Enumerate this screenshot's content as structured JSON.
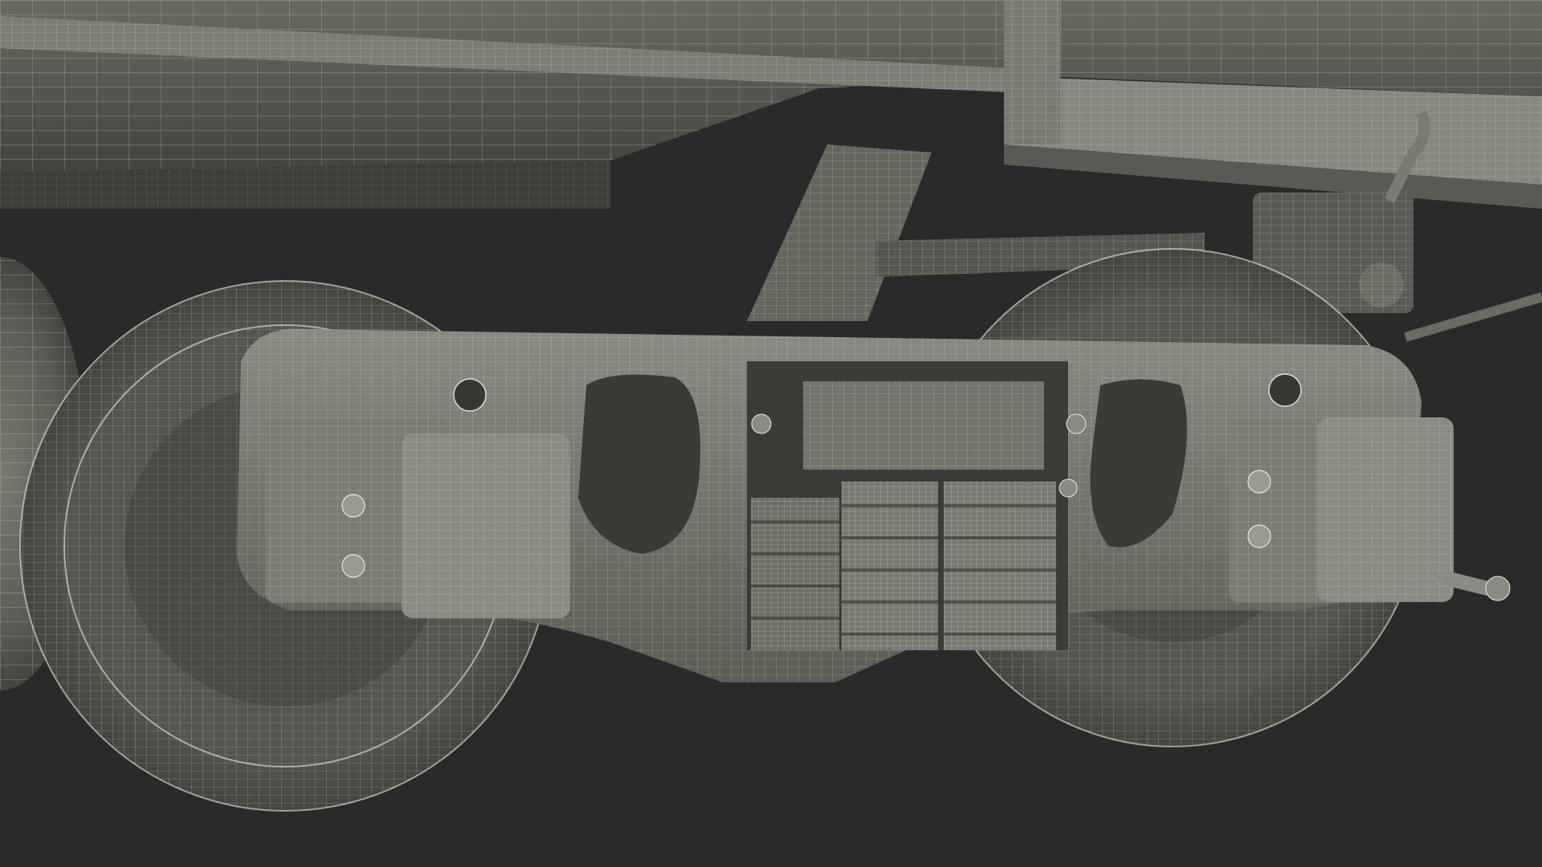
{
  "scene": {
    "subject": "railcar-bogie-wireframe",
    "colors": {
      "background": "#2a2a2a",
      "surface_dark": "#4a4a46",
      "surface_mid": "#6b6b64",
      "surface_light": "#8d8d85",
      "wire": "#e8e8dc"
    }
  }
}
